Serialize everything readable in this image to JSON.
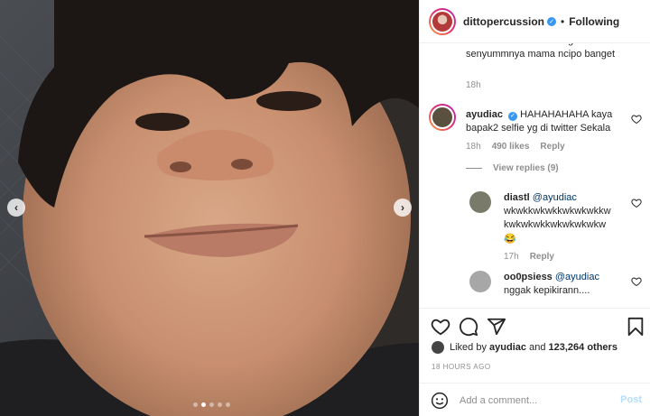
{
  "header": {
    "username": "dittopercussion",
    "separator": "•",
    "follow_status": "Following"
  },
  "comments": {
    "partial": {
      "text": "Sekala Selfie hahahha geser senyummnya mama ncipo banget",
      "time": "18h"
    },
    "main": {
      "username": "ayudiac",
      "text": "HAHAHAHAHA kaya bapak2 selfie yg di twitter Sekala",
      "time": "18h",
      "likes": "490 likes",
      "reply": "Reply",
      "view_replies": "View replies (9)"
    },
    "reply1": {
      "username": "diastl",
      "mention": "@ayudiac",
      "text": "wkwkkwkwkkwkwkwkkw kwkwkwkkwkwkwkwkw",
      "emoji": "😂",
      "time": "17h",
      "reply": "Reply"
    },
    "reply2": {
      "username": "oo0psiess",
      "mention": "@ayudiac",
      "text": "nggak kepikirann...."
    }
  },
  "likes_line": {
    "prefix": "Liked by",
    "user": "ayudiac",
    "and": "and",
    "count": "123,264 others"
  },
  "time_ago": "18 HOURS AGO",
  "add_comment": {
    "placeholder": "Add a comment...",
    "post_label": "Post"
  },
  "carousel": {
    "dots": 5,
    "active_index": 1
  },
  "icons": {
    "prev": "chevron-left-icon",
    "next": "chevron-right-icon",
    "like": "heart-icon",
    "comment": "comment-icon",
    "share": "share-icon",
    "save": "bookmark-icon",
    "emoji": "emoji-icon"
  },
  "colors": {
    "verified": "#3897f0",
    "post_disabled": "#b2dffc",
    "muted": "#8e8e8e"
  }
}
